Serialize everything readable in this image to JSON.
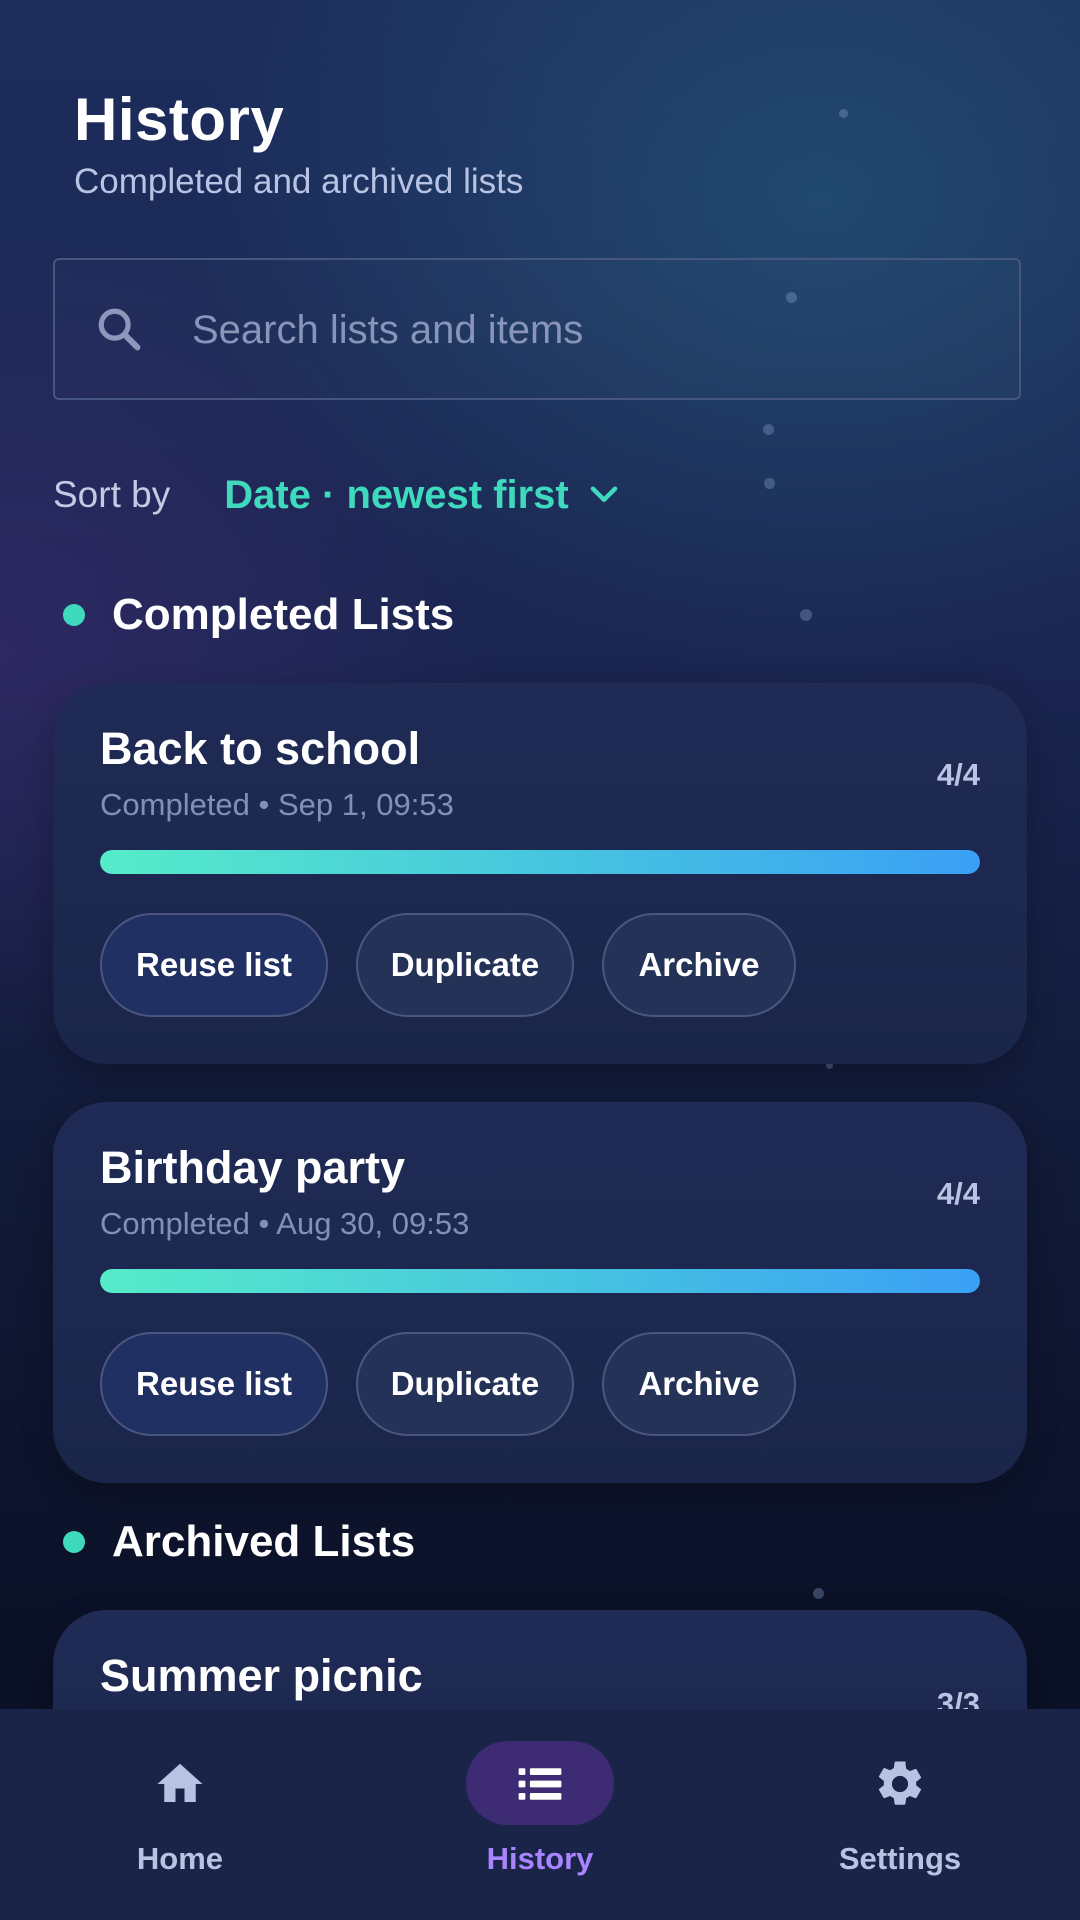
{
  "header": {
    "title": "History",
    "subtitle": "Completed and archived lists"
  },
  "search": {
    "placeholder": "Search lists and items",
    "value": "",
    "icon": "search-icon"
  },
  "sort": {
    "label": "Sort by",
    "selected": "Date · newest first",
    "icon": "chevron-down-icon"
  },
  "sections": {
    "completed": {
      "title": "Completed Lists"
    },
    "archived": {
      "title": "Archived Lists"
    }
  },
  "cards": [
    {
      "title": "Back to school",
      "meta": "Completed • Sep 1, 09:53",
      "count": "4/4",
      "progress": 1.0,
      "actions": {
        "reuse": "Reuse list",
        "duplicate": "Duplicate",
        "archive": "Archive"
      }
    },
    {
      "title": "Birthday party",
      "meta": "Completed • Aug 30, 09:53",
      "count": "4/4",
      "progress": 1.0,
      "actions": {
        "reuse": "Reuse list",
        "duplicate": "Duplicate",
        "archive": "Archive"
      }
    },
    {
      "title": "Summer picnic",
      "count": "3/3"
    }
  ],
  "nav": {
    "items": [
      {
        "label": "Home",
        "icon": "home-icon",
        "active": false
      },
      {
        "label": "History",
        "icon": "list-icon",
        "active": true
      },
      {
        "label": "Settings",
        "icon": "gear-icon",
        "active": false
      }
    ]
  },
  "colors": {
    "accent": "#3fd9bd",
    "active_nav": "#a984ff",
    "progress_start": "#55ecc9",
    "progress_end": "#3aa0f5"
  }
}
